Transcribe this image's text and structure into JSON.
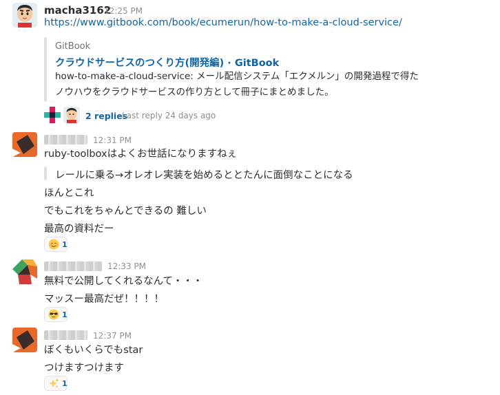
{
  "messages": [
    {
      "user": "macha3162",
      "time": "12:25 PM",
      "text": "https://www.gitbook.com/book/ecumerun/how-to-make-a-cloud-service/",
      "attachment": {
        "service": "GitBook",
        "title": "クラウドサービスのつくり方(開発編) · GitBook",
        "text_line1": "how-to-make-a-cloud-service: メール配信システム「エクメルン」の開発過程で得た",
        "text_line2": "ノウハウをクラウドサービスの作り方として冊子にまとめました。"
      },
      "thread": {
        "replies": "2 replies",
        "last_reply": "Last reply 24 days ago"
      }
    },
    {
      "time": "12:31 PM",
      "lines": [
        "ruby-toolboxはよくお世話になりますねぇ"
      ],
      "quote": "レールに乗る→オレオレ実装を始めるととたんに面倒なことになる",
      "after": [
        "ほんとこれ",
        "でもこれをちゃんとできるの 難しい",
        "最高の資料だー"
      ],
      "reaction": {
        "emoji": "blush-emoji",
        "count": "1"
      }
    },
    {
      "time": "12:33 PM",
      "lines": [
        "無料で公開してくれるなんて・・・",
        "マッスー最高だぜ！！！！"
      ],
      "reaction": {
        "emoji": "sunglasses-emoji",
        "count": "1"
      }
    },
    {
      "time": "12:37 PM",
      "lines": [
        "ぼくもいくらでもstar",
        "つけますつけます"
      ],
      "reaction": {
        "emoji": "sparkles-emoji",
        "count": "1"
      }
    }
  ],
  "colors": {
    "link": "#1264a3",
    "text": "#2c2d30",
    "muted": "#8f8f8f",
    "orange": "#e8692a",
    "dark": "#3b2b2b"
  }
}
